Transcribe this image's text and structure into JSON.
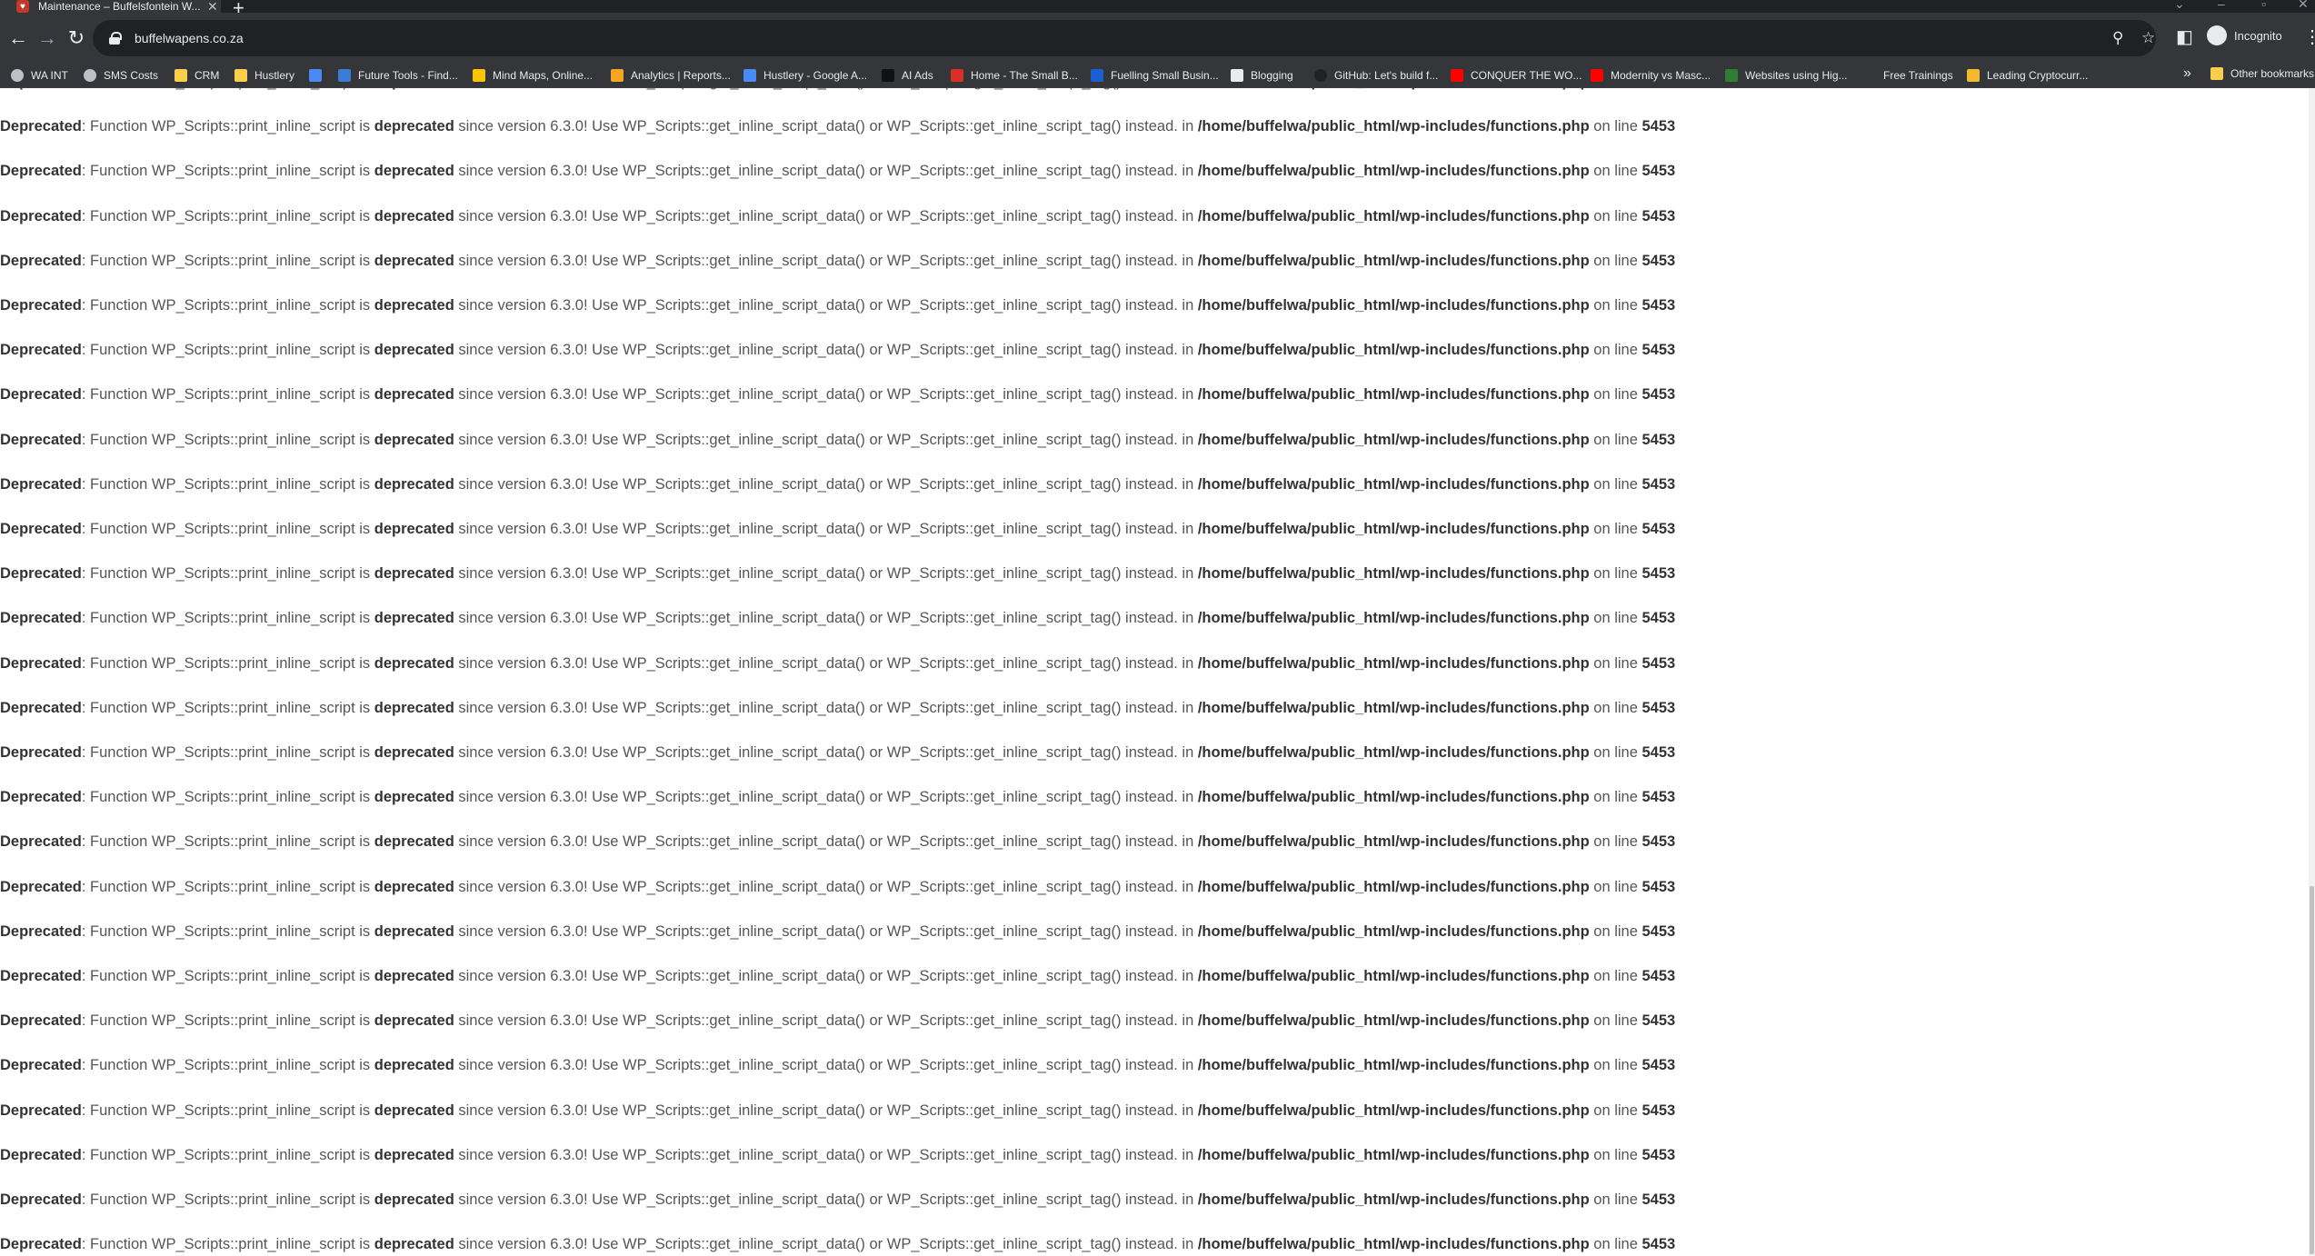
{
  "browser": {
    "tab_title": "Maintenance – Buffelsfontein W...",
    "url": "buffelwapens.co.za",
    "incognito_label": "Incognito",
    "bookmarks": [
      {
        "label": "WA INT",
        "icon": "globe-icon",
        "color": "#bdc1c6"
      },
      {
        "label": "SMS Costs",
        "icon": "globe-icon",
        "color": "#bdc1c6"
      },
      {
        "label": "CRM",
        "icon": "folder-icon",
        "color": "#f9ce4b"
      },
      {
        "label": "Hustlery",
        "icon": "folder-icon",
        "color": "#f9ce4b"
      },
      {
        "label": "",
        "icon": "docs-icon",
        "color": "#4a8af4"
      },
      {
        "label": "Future Tools - Find...",
        "icon": "futuretools-icon",
        "color": "#3a7bd5"
      },
      {
        "label": "Mind Maps, Online...",
        "icon": "mindmap-icon",
        "color": "#f7c600"
      },
      {
        "label": "Analytics | Reports...",
        "icon": "analytics-icon",
        "color": "#f4a522"
      },
      {
        "label": "Hustlery - Google A...",
        "icon": "google-ads-icon",
        "color": "#4a8af4"
      },
      {
        "label": "AI Ads",
        "icon": "ai-ads-icon",
        "color": "#111111"
      },
      {
        "label": "Home - The Small B...",
        "icon": "smallbiz-icon",
        "color": "#d93025"
      },
      {
        "label": "Fuelling Small Busin...",
        "icon": "fuelling-icon",
        "color": "#1a5fd1"
      },
      {
        "label": "Blogging",
        "icon": "blogging-icon",
        "color": "#e8eaed"
      },
      {
        "label": "GitHub: Let's build f...",
        "icon": "github-icon",
        "color": "#202124"
      },
      {
        "label": "CONQUER THE WO...",
        "icon": "youtube-icon",
        "color": "#ff0000"
      },
      {
        "label": "Modernity vs Masc...",
        "icon": "youtube-icon",
        "color": "#ff0000"
      },
      {
        "label": "Websites using Hig...",
        "icon": "leaf-icon",
        "color": "#2e7d32"
      },
      {
        "label": "Free Trainings",
        "icon": "training-icon",
        "color": "#35363a"
      },
      {
        "label": "Leading Cryptocurr...",
        "icon": "crypto-icon",
        "color": "#f3ba2f"
      }
    ],
    "other_bookmarks": "Other bookmarks"
  },
  "page": {
    "warning": {
      "prefix": "Deprecated",
      "text_a": ": Function WP_Scripts::print_inline_script is ",
      "bold_a": "deprecated",
      "text_b": " since version 6.3.0! Use WP_Scripts::get_inline_script_data() or WP_Scripts::get_inline_script_tag() instead. in ",
      "path": "/home/buffelwa/public_html/wp-includes/functions.php",
      "text_c": " on line ",
      "line": "5453"
    },
    "visible_line_count": 27
  }
}
